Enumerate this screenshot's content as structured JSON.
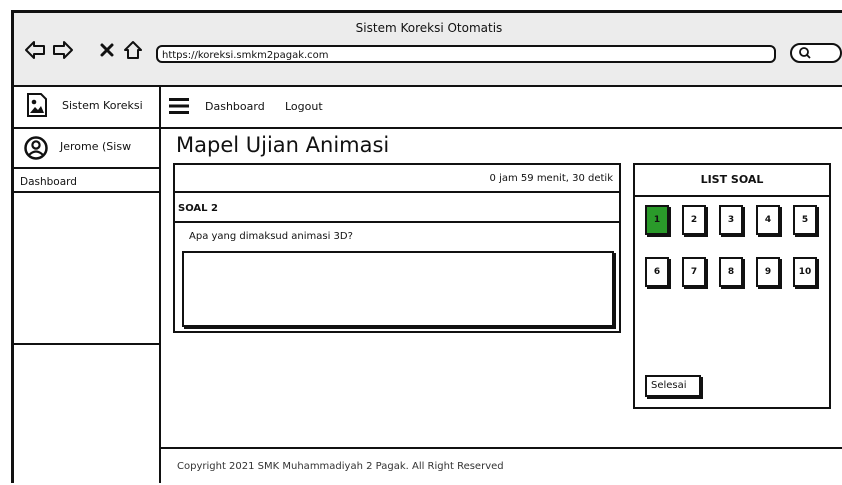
{
  "window": {
    "title": "Sistem Koreksi Otomatis",
    "url": "https://koreksi.smkm2pagak.com",
    "icons": [
      "arrow-left-icon",
      "arrow-right-icon",
      "close-icon",
      "home-icon",
      "search-icon"
    ]
  },
  "sidebar": {
    "brand": "Sistem Koreksi",
    "user": "Jerome (Sisw",
    "menu": [
      "Dashboard"
    ]
  },
  "nav": {
    "dashboard": "Dashboard",
    "logout": "Logout"
  },
  "page": {
    "title": "Mapel Ujian Animasi",
    "timer": "0 jam 59 menit, 30 detik",
    "question_label": "SOAL 2",
    "question_text": "Apa yang dimaksud animasi 3D?",
    "answer_value": ""
  },
  "list": {
    "title": "LIST SOAL",
    "numbers": [
      "1",
      "2",
      "3",
      "4",
      "5",
      "6",
      "7",
      "8",
      "9",
      "10"
    ],
    "active": "1",
    "finish": "Selesai"
  },
  "footer": {
    "text": "Copyright 2021 SMK Muhammadiyah 2 Pagak. All Right Reserved"
  },
  "colors": {
    "active_question": "#2a9a2a",
    "titlebar": "#ececec"
  }
}
